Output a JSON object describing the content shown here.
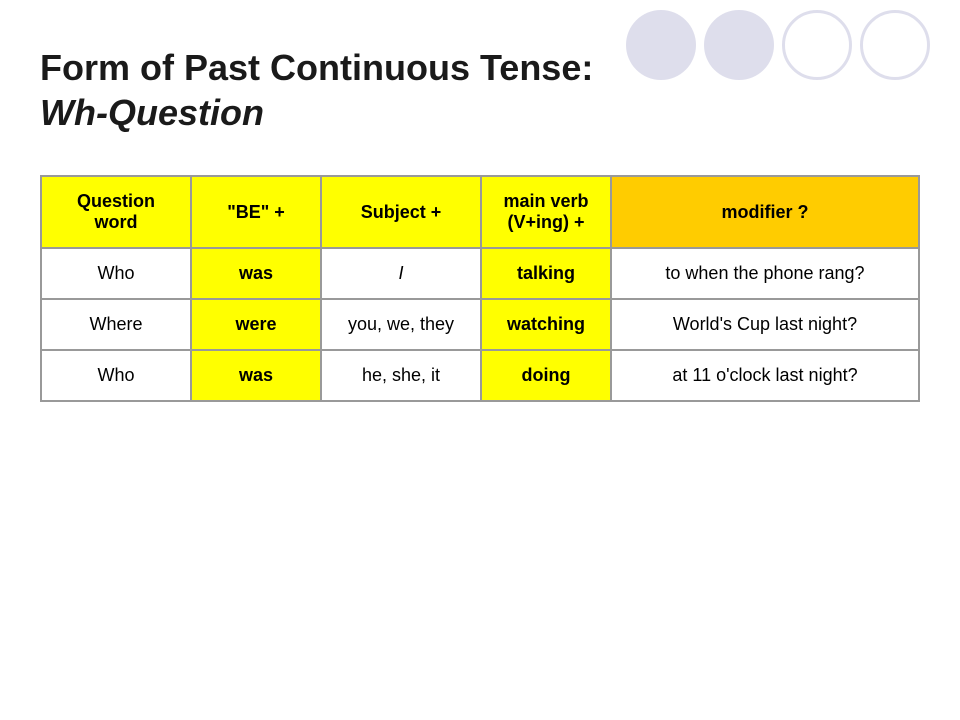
{
  "title": {
    "line1": "Form of Past Continuous Tense:",
    "line2": "Wh-Question"
  },
  "table": {
    "headers": {
      "qword": "Question word",
      "be": "\"BE\" +",
      "subject": "Subject +",
      "mainverb": "main verb (V+ing) +",
      "modifier": "modifier ?"
    },
    "rows": [
      {
        "qword": "Who",
        "be": "was",
        "subject": "I",
        "mainverb": "talking",
        "modifier": "to when the phone rang?"
      },
      {
        "qword": "Where",
        "be": "were",
        "subject": "you, we, they",
        "mainverb": "watching",
        "modifier": "World's Cup last night?"
      },
      {
        "qword": "Who",
        "be": "was",
        "subject": "he, she, it",
        "mainverb": "doing",
        "modifier": "at 11 o'clock last night?"
      }
    ]
  }
}
